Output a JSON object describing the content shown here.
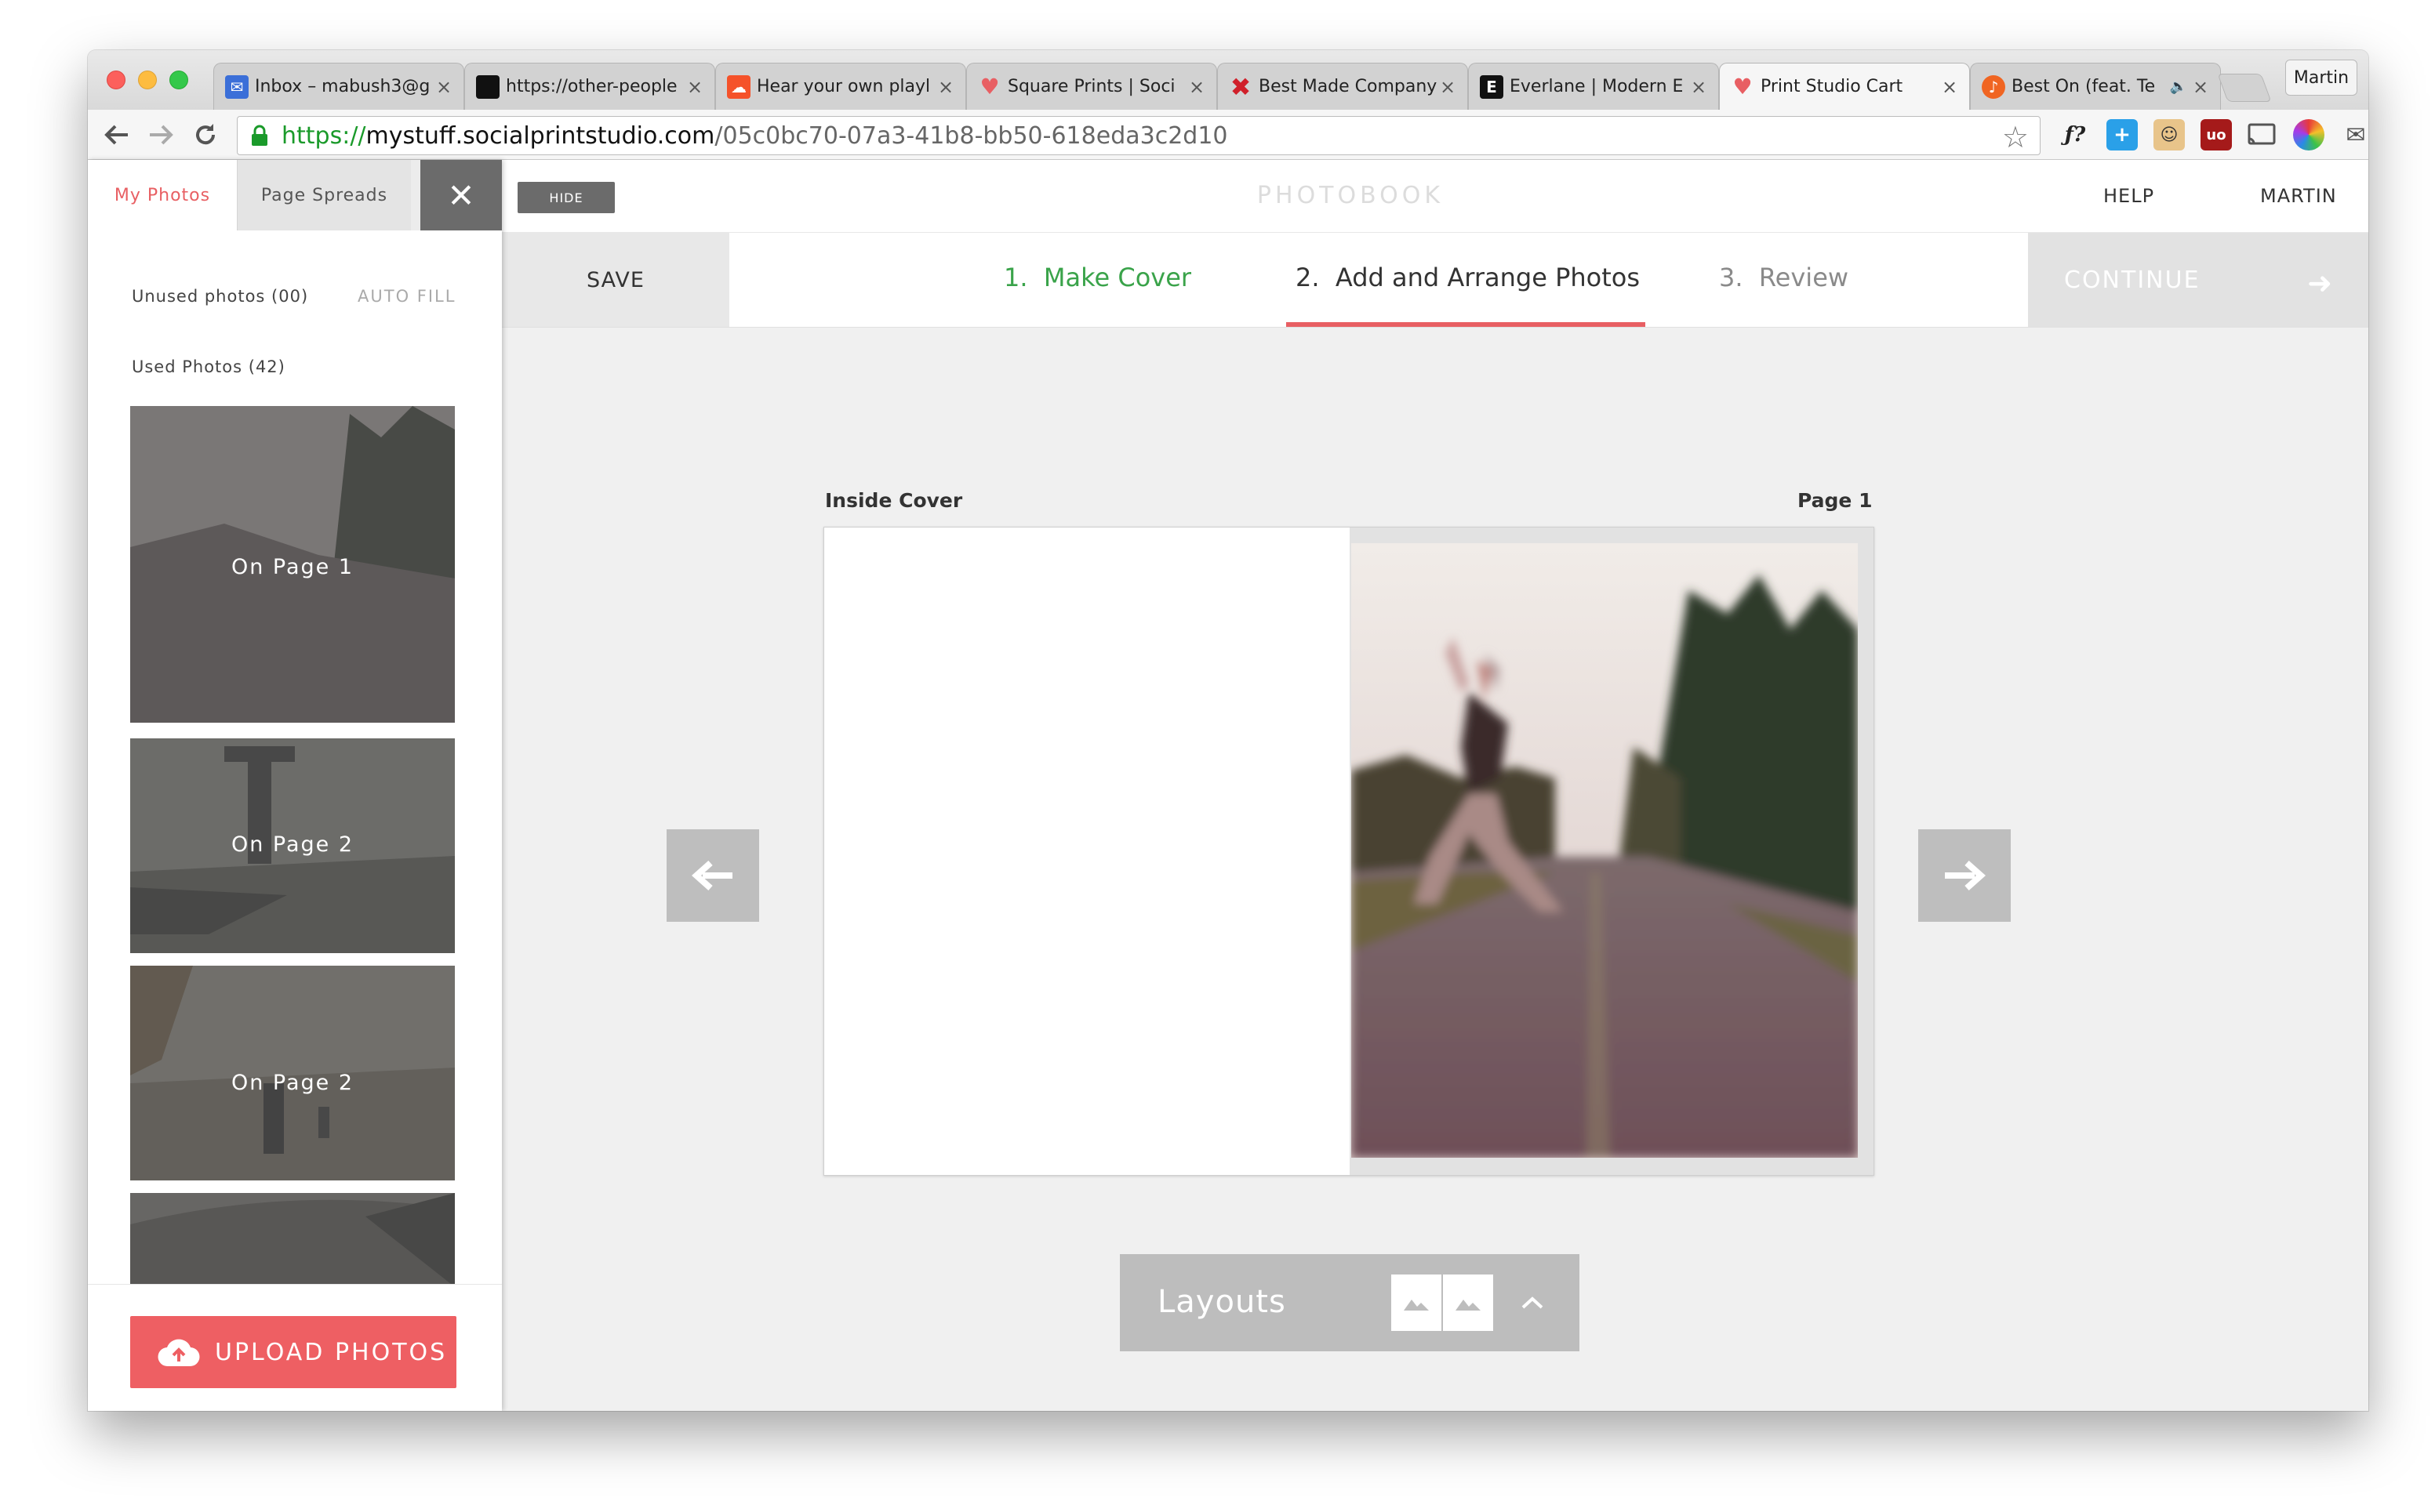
{
  "browser": {
    "tabs": [
      {
        "title": "Inbox – mabush3@g",
        "icon": "mail-icon",
        "color": "#3b6fd8"
      },
      {
        "title": "https://other-people",
        "icon": "black-square-icon",
        "color": "#111111"
      },
      {
        "title": "Hear your own playl",
        "icon": "soundcloud-icon",
        "color": "#f5522a"
      },
      {
        "title": "Square Prints | Soci",
        "icon": "heart-logo-icon",
        "color": "#e85f63"
      },
      {
        "title": "Best Made Company",
        "icon": "red-x-icon",
        "color": "#d0202a"
      },
      {
        "title": "Everlane | Modern E",
        "icon": "everlane-e-icon",
        "color": "#111111"
      },
      {
        "title": "Print Studio Cart",
        "icon": "heart-logo-icon",
        "color": "#e85f63"
      },
      {
        "title": "Best On (feat. Te",
        "icon": "music-note-icon",
        "color": "#f06522"
      }
    ],
    "active_tab_index": 6,
    "profile_name": "Martin",
    "url": {
      "protocol": "https://",
      "host": "mystuff.socialprintstudio.com",
      "path": "/05c0bc70-07a3-41b8-bb50-618eda3c2d10"
    }
  },
  "app": {
    "hide_label": "HIDE",
    "brand": "PHOTOBOOK",
    "help_label": "HELP",
    "user_label": "MARTIN",
    "save_label": "SAVE",
    "steps": [
      {
        "number": "1.",
        "label": "Make Cover",
        "state": "done"
      },
      {
        "number": "2.",
        "label": "Add and Arrange Photos",
        "state": "active"
      },
      {
        "number": "3.",
        "label": "Review",
        "state": "upcoming"
      }
    ],
    "continue_label": "CONTINUE",
    "colors": {
      "accent": "#e85f63",
      "done": "#3aa34a"
    }
  },
  "sidebar": {
    "tab_my_photos": "My Photos",
    "tab_page_spreads": "Page Spreads",
    "unused_label": "Unused photos (00)",
    "auto_fill_label": "AUTO FILL",
    "used_label": "Used Photos (42)",
    "photos": [
      {
        "label": "On Page 1"
      },
      {
        "label": "On Page 2"
      },
      {
        "label": "On Page 2"
      },
      {
        "label": ""
      }
    ],
    "upload_label": "UPLOAD PHOTOS"
  },
  "canvas": {
    "left_page_label": "Inside Cover",
    "right_page_label": "Page 1",
    "layouts_label": "Layouts"
  }
}
